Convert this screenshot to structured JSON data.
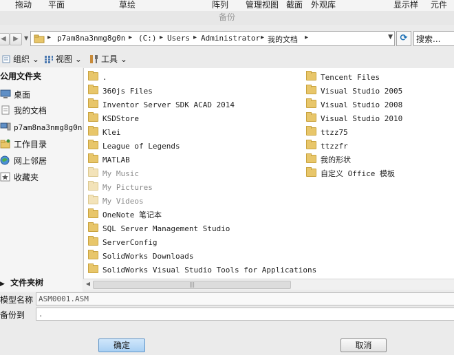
{
  "ribbon": [
    "拖动",
    "平面",
    "草绘",
    "阵列",
    "管理视图",
    "截面",
    "外观库",
    "显示样",
    "元件"
  ],
  "dialog": {
    "title": "备份"
  },
  "address": {
    "segments": [
      "p7am8na3nmg8g0n",
      "(C:)",
      "Users",
      "Administrator",
      "我的文档"
    ],
    "search_placeholder": "搜索..."
  },
  "toolbar": {
    "organize": "组织",
    "views": "视图",
    "tools": "工具"
  },
  "sidebar": {
    "header": "公用文件夹",
    "items": [
      "桌面",
      "我的文档",
      "p7am8na3nmg8g0n",
      "工作目录",
      "网上邻居",
      "收藏夹"
    ],
    "tree_label": "文件夹树"
  },
  "files": {
    "left": [
      {
        "name": ".",
        "dim": false
      },
      {
        "name": "360js Files",
        "dim": false
      },
      {
        "name": "Inventor Server SDK ACAD 2014",
        "dim": false
      },
      {
        "name": "KSDStore",
        "dim": false
      },
      {
        "name": "Klei",
        "dim": false
      },
      {
        "name": "League of Legends",
        "dim": false
      },
      {
        "name": "MATLAB",
        "dim": false
      },
      {
        "name": "My Music",
        "dim": true
      },
      {
        "name": "My Pictures",
        "dim": true
      },
      {
        "name": "My Videos",
        "dim": true
      },
      {
        "name": "OneNote 笔记本",
        "dim": false
      },
      {
        "name": "SQL Server Management Studio",
        "dim": false
      },
      {
        "name": "ServerConfig",
        "dim": false
      },
      {
        "name": "SolidWorks Downloads",
        "dim": false
      },
      {
        "name": "SolidWorks Visual Studio Tools for Applications",
        "dim": false
      }
    ],
    "right": [
      {
        "name": "Tencent Files",
        "dim": false
      },
      {
        "name": "Visual Studio 2005",
        "dim": false
      },
      {
        "name": "Visual Studio 2008",
        "dim": false
      },
      {
        "name": "Visual Studio 2010",
        "dim": false
      },
      {
        "name": "ttzz75",
        "dim": false
      },
      {
        "name": "ttzzfr",
        "dim": false
      },
      {
        "name": "我的形状",
        "dim": false
      },
      {
        "name": "自定义 Office 模板",
        "dim": false
      }
    ]
  },
  "fields": {
    "model_label": "模型名称",
    "model_value": "ASM0001.ASM",
    "backup_label": "备份到",
    "backup_value": "."
  },
  "buttons": {
    "ok": "确定",
    "cancel": "取消"
  },
  "colors": {
    "folder": "#e8c66a",
    "ok_button": "#a9d0f3",
    "refresh_icon": "#1a6fb5"
  }
}
